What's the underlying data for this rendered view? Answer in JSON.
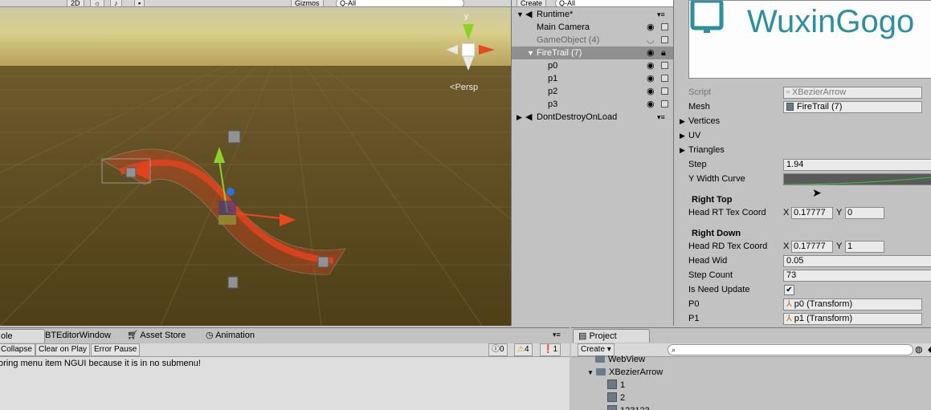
{
  "scene": {
    "toolbar": {
      "mode_2d": "2D",
      "gizmos": "Gizmos",
      "search_placeholder": "Q-All"
    },
    "persp_label": "Persp",
    "gizmo_axis_y": "y"
  },
  "hierarchy": {
    "create_label": "Create",
    "search_placeholder": "Q-All",
    "items": [
      {
        "label": "Runtime*"
      },
      {
        "label": "Main Camera"
      },
      {
        "label": "GameObject (4)"
      },
      {
        "label": "FireTrail (7)"
      },
      {
        "label": "p0"
      },
      {
        "label": "p1"
      },
      {
        "label": "p2"
      },
      {
        "label": "p3"
      },
      {
        "label": "DontDestroyOnLoad"
      }
    ]
  },
  "inspector": {
    "banner_text": "WuxinGogo",
    "script_label": "Script",
    "script_value": "XBezierArrow",
    "mesh_label": "Mesh",
    "mesh_value": "FireTrail (7)",
    "vertices_label": "Vertices",
    "uv_label": "UV",
    "triangles_label": "Triangles",
    "step_label": "Step",
    "step_value": "1.94",
    "y_width_curve_label": "Y Width Curve",
    "right_top_header": "Right Top",
    "head_rt_label": "Head RT Tex Coord",
    "head_rt_x_label": "X",
    "head_rt_x": "0.17777",
    "head_rt_y_label": "Y",
    "head_rt_y": "0",
    "right_down_header": "Right Down",
    "head_rd_label": "Head RD Tex Coord",
    "head_rd_x_label": "X",
    "head_rd_x": "0.17777",
    "head_rd_y_label": "Y",
    "head_rd_y": "1",
    "head_wid_label": "Head Wid",
    "head_wid_value": "0.05",
    "step_count_label": "Step Count",
    "step_count_value": "73",
    "need_update_label": "Is Need Update",
    "need_update_checked": true,
    "p0_label": "P0",
    "p0_value": "p0 (Transform)",
    "p1_label": "P1",
    "p1_value": "p1 (Transform)"
  },
  "console": {
    "tabs": [
      {
        "label": "ole"
      },
      {
        "label": "BTEditorWindow"
      },
      {
        "label": "Asset Store"
      },
      {
        "label": "Animation"
      }
    ],
    "toolbar": {
      "collapse": "Collapse",
      "clear_on_play": "Clear on Play",
      "error_pause": "Error Pause"
    },
    "counts": {
      "info": "0",
      "warning": "4",
      "error": "1"
    },
    "message": "oring menu item NGUI because it is in no submenu!"
  },
  "project": {
    "tab_label": "Project",
    "create_label": "Create",
    "items": [
      {
        "label": "WebView"
      },
      {
        "label": "XBezierArrow"
      },
      {
        "label": "1"
      },
      {
        "label": "2"
      },
      {
        "label": "123123"
      }
    ]
  },
  "colors": {
    "sky_top": "#c8c39a",
    "ground": "#5c4a1f",
    "arrow_red": "#e2431f",
    "selection": "#8f8f8f",
    "x_axis": "#e84820",
    "y_axis": "#8ed02a",
    "banner_teal": "#2e8fa0"
  }
}
